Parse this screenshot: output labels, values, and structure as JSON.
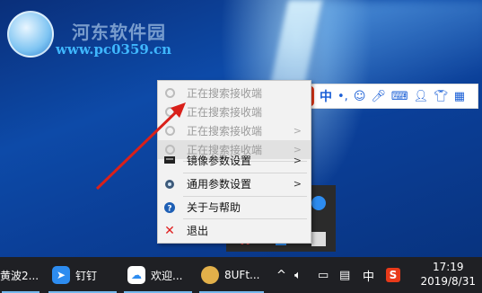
{
  "watermark": {
    "site_name": "河东软件园",
    "url": "www.pc0359.cn"
  },
  "context_menu": {
    "items": [
      {
        "label": "正在搜索接收端",
        "disabled": true,
        "has_submenu": false,
        "icon": "gear-icon"
      },
      {
        "label": "正在搜索接收端",
        "disabled": true,
        "has_submenu": false,
        "icon": "gear-icon"
      },
      {
        "label": "正在搜索接收端",
        "disabled": true,
        "has_submenu": true,
        "icon": "gear-icon"
      },
      {
        "label": "正在搜索接收端",
        "disabled": true,
        "has_submenu": true,
        "icon": "gear-icon"
      },
      {
        "label": "镜像参数设置",
        "disabled": false,
        "has_submenu": true,
        "icon": "monitor-icon"
      },
      {
        "label": "通用参数设置",
        "disabled": false,
        "has_submenu": true,
        "icon": "settings-icon"
      },
      {
        "label": "关于与帮助",
        "disabled": false,
        "has_submenu": false,
        "icon": "help-icon"
      },
      {
        "label": "退出",
        "disabled": false,
        "has_submenu": false,
        "icon": "close-icon"
      }
    ]
  },
  "ime_toolbar": {
    "logo": "S",
    "mode": "中",
    "punct": "•,",
    "icons": [
      "emoji-icon",
      "mic-icon",
      "keyboard-icon",
      "user-icon",
      "shirt-icon",
      "grid-icon"
    ]
  },
  "taskbar": {
    "items": [
      {
        "label": "黄波2...",
        "icon": ""
      },
      {
        "label": "钉钉",
        "icon": "dingtalk-icon"
      },
      {
        "label": "欢迎...",
        "icon": "baidu-netdisk-icon"
      },
      {
        "label": "8UFt...",
        "icon": "app-icon"
      }
    ],
    "tray_lang": "中",
    "clock_time": "17:19",
    "clock_date": "2019/8/31"
  },
  "colors": {
    "annotation_arrow": "#d9201a",
    "ime_brand": "#e83a1a",
    "accent_blue": "#1a5fd6"
  }
}
